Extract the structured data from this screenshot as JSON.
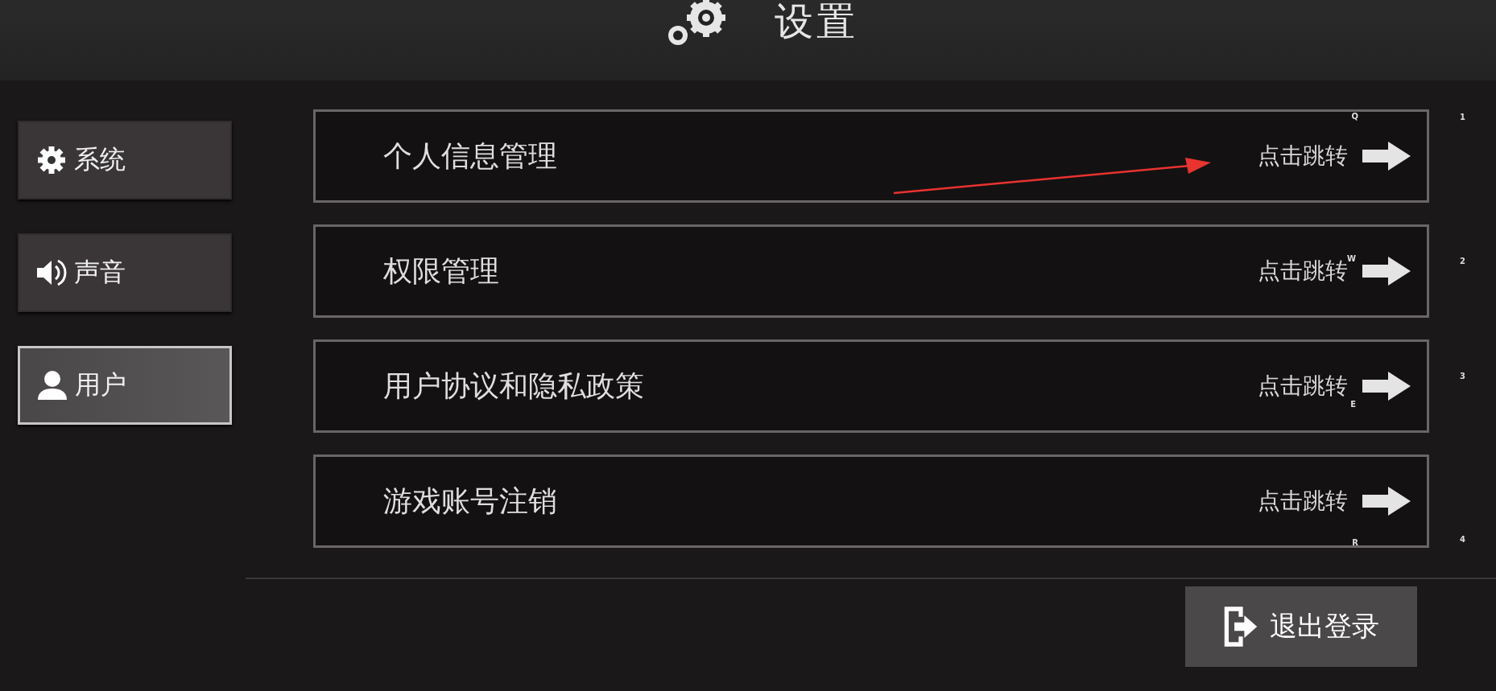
{
  "title": "设置",
  "sidebar": {
    "items": [
      {
        "kind": "gear",
        "label": "系统",
        "selected": false
      },
      {
        "kind": "sound",
        "label": "声音",
        "selected": false
      },
      {
        "kind": "user",
        "label": "用户",
        "selected": true
      }
    ]
  },
  "rows": [
    {
      "label": "个人信息管理",
      "action": "点击跳转",
      "hotkey": "Q",
      "number": "1"
    },
    {
      "label": "权限管理",
      "action": "点击跳转",
      "hotkey": "W",
      "number": "2"
    },
    {
      "label": "用户协议和隐私政策",
      "action": "点击跳转",
      "hotkey": "E",
      "number": "3"
    },
    {
      "label": "游戏账号注销",
      "action": "点击跳转",
      "hotkey": "R",
      "number": "4"
    }
  ],
  "logout_button": {
    "label": "退出登录"
  }
}
